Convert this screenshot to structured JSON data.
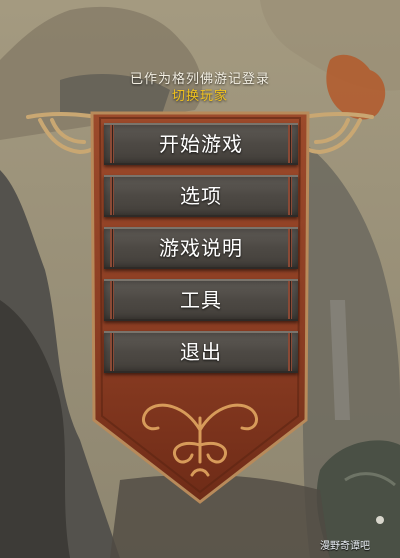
{
  "header": {
    "login_status": "已作为格列佛游记登录",
    "switch_player": "切换玩家"
  },
  "menu": {
    "items": [
      {
        "label": "开始游戏",
        "name": "start-game-button"
      },
      {
        "label": "选项",
        "name": "options-button"
      },
      {
        "label": "游戏说明",
        "name": "game-instructions-button"
      },
      {
        "label": "工具",
        "name": "tools-button"
      },
      {
        "label": "退出",
        "name": "exit-button"
      }
    ]
  },
  "watermark": "漫野奇谭吧",
  "colors": {
    "banner": "#8a3a22",
    "button": "#4d4944",
    "switch_text": "#f0c21e",
    "sky": "#9b9278"
  }
}
